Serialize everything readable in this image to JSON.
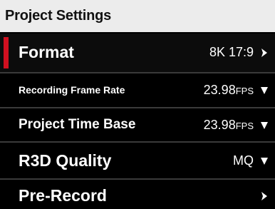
{
  "header": {
    "title": "Project Settings"
  },
  "rows": [
    {
      "label": "Format",
      "value": "8K 17:9",
      "unit": "",
      "control": "chevron-right",
      "selected": true
    },
    {
      "label": "Recording Frame Rate",
      "value": "23.98",
      "unit": "FPS",
      "control": "chevron-down",
      "selected": false
    },
    {
      "label": "Project Time Base",
      "value": "23.98",
      "unit": "FPS",
      "control": "chevron-down",
      "selected": false
    },
    {
      "label": "R3D Quality",
      "value": "MQ",
      "unit": "",
      "control": "chevron-down",
      "selected": false
    },
    {
      "label": "Pre-Record",
      "value": "",
      "unit": "",
      "control": "chevron-right",
      "selected": false
    }
  ],
  "colors": {
    "accent": "#d01020",
    "header_bg": "#ececec",
    "row_bg": "#000000",
    "text": "#ffffff"
  }
}
